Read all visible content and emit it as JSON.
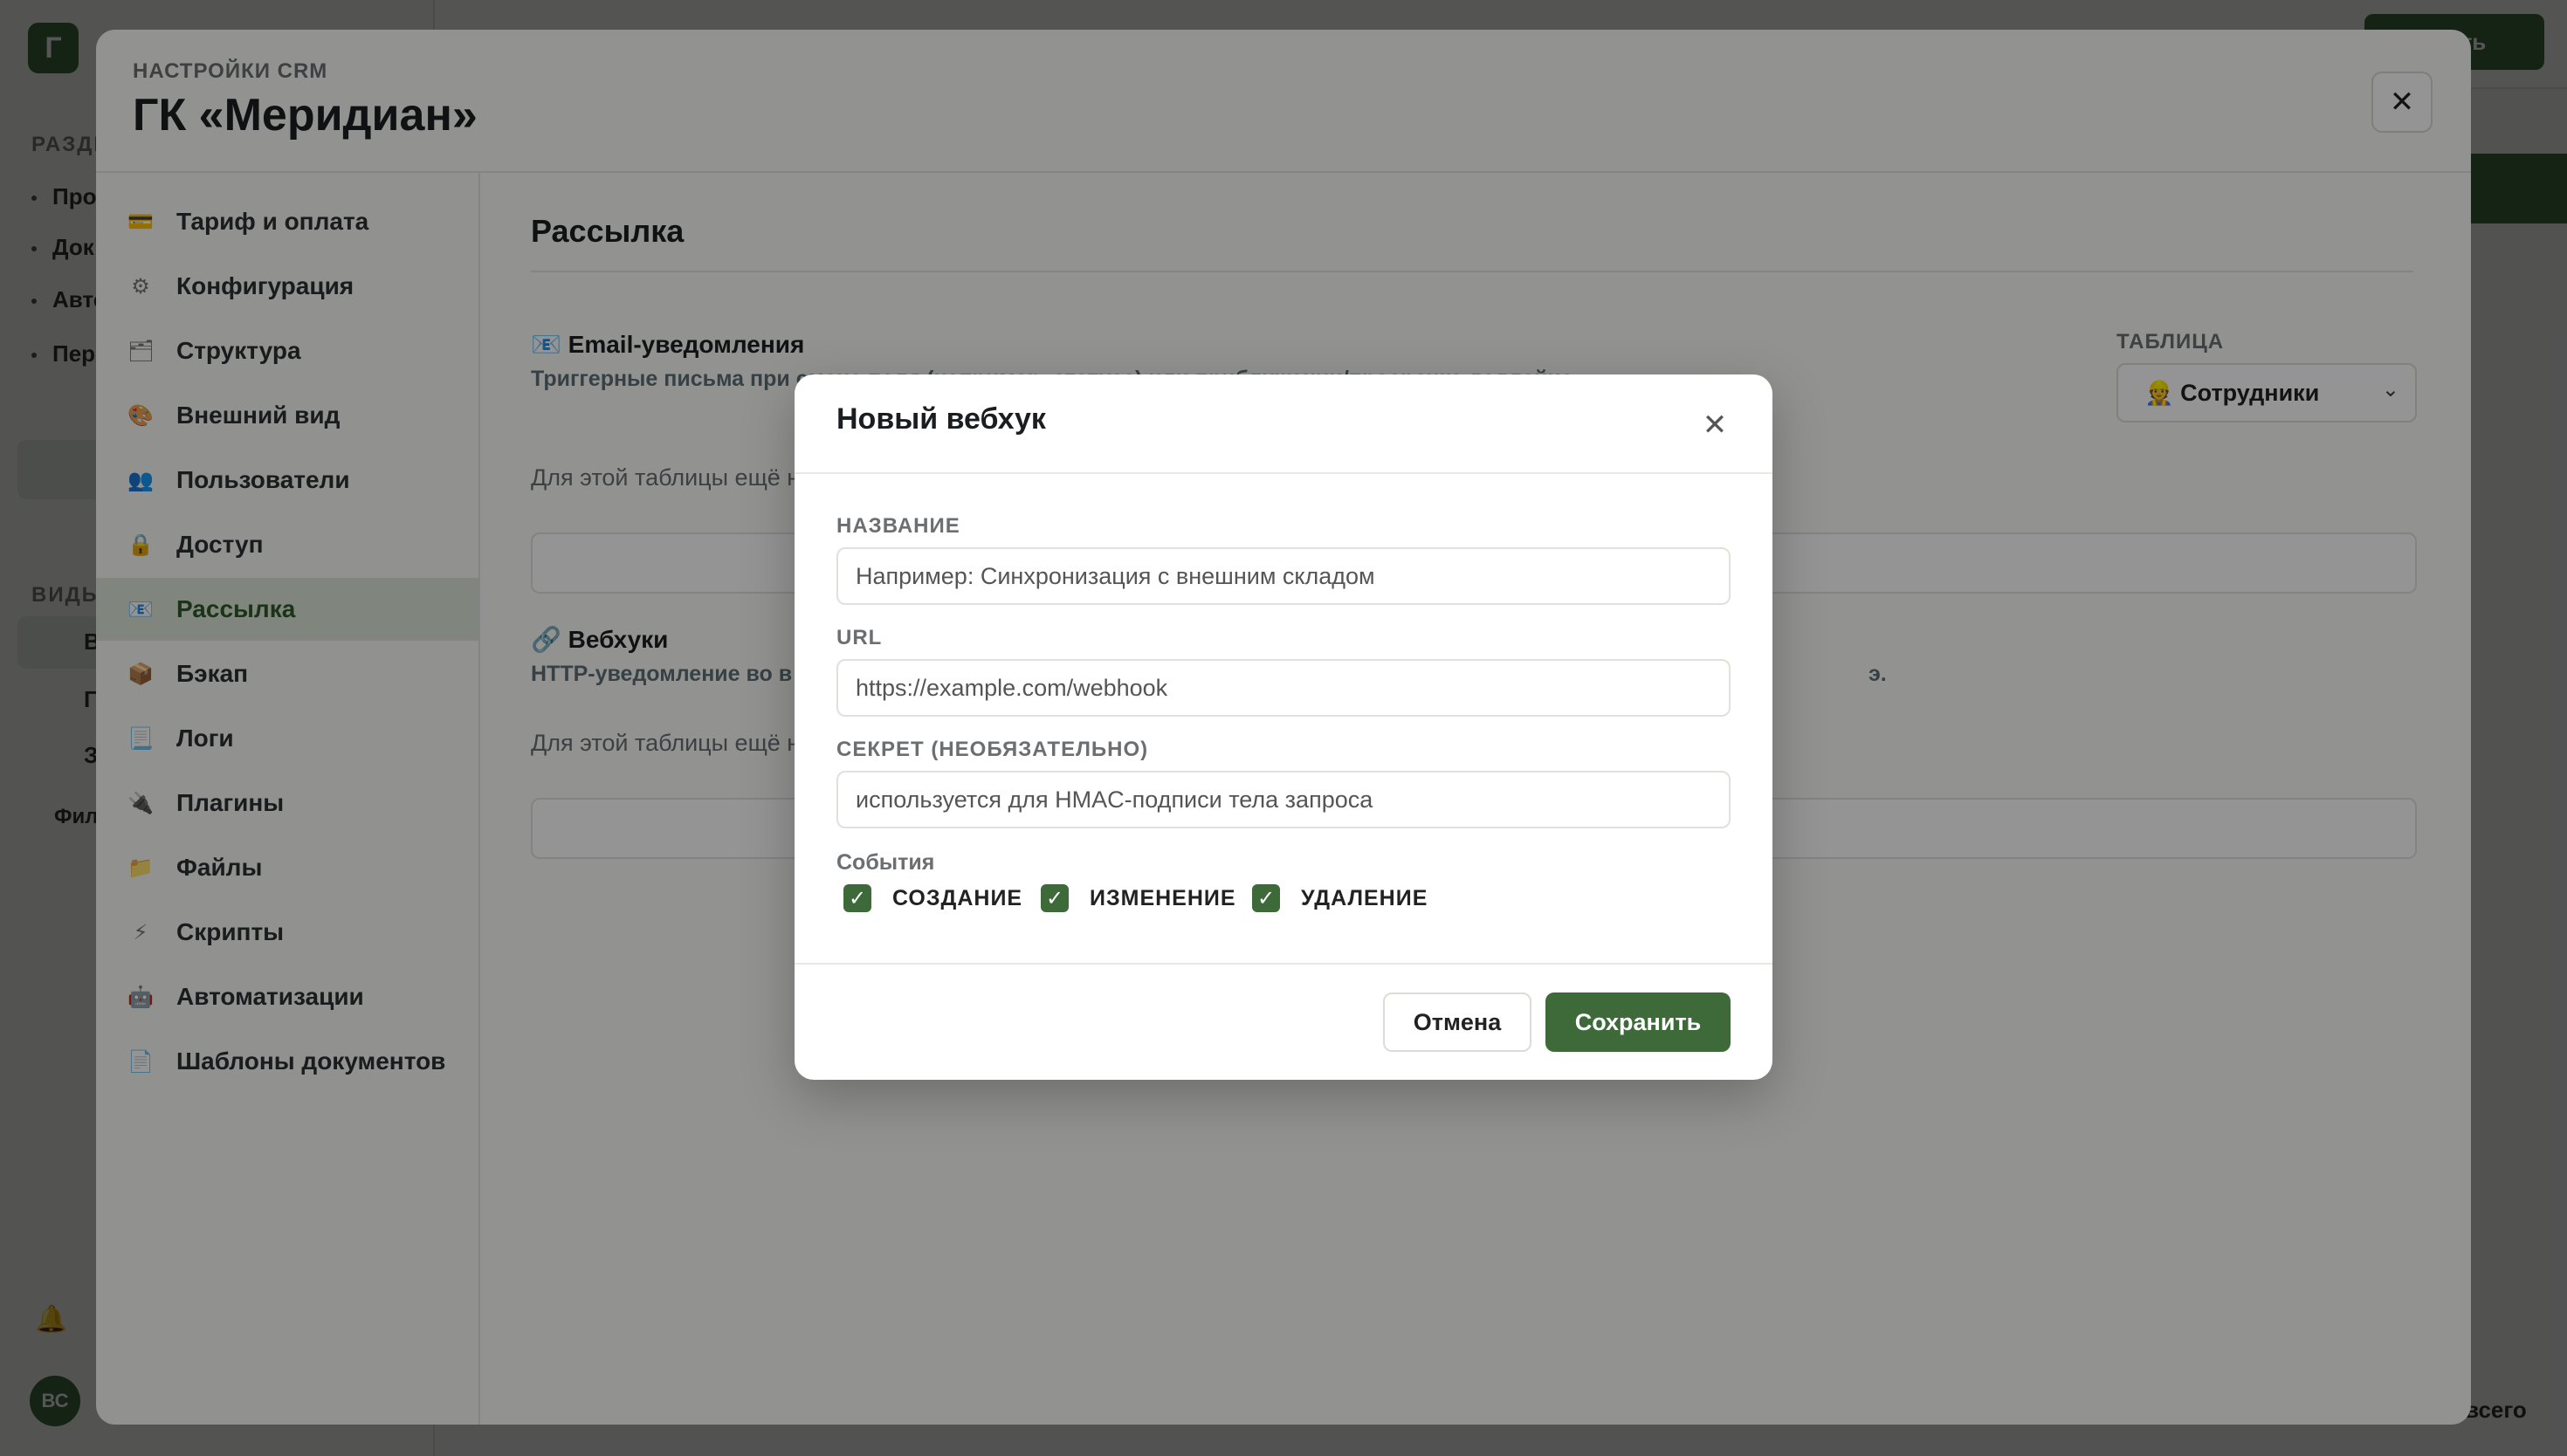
{
  "app": {
    "logo": "Г",
    "sections_label": "РАЗДЕ",
    "items": [
      "Про",
      "Док",
      "Авто",
      "Пер"
    ],
    "views_label": "ВИДЫ",
    "view_items": [
      "В",
      "Г",
      "З"
    ],
    "filter": "Фил",
    "top_button": "здать",
    "total": "о всего",
    "avatar": "ВС"
  },
  "settings": {
    "eyebrow": "НАСТРОЙКИ CRM",
    "title": "ГК «Меридиан»",
    "close_icon": "✕",
    "nav": [
      {
        "icon": "💳",
        "label": "Тариф и оплата"
      },
      {
        "icon": "⚙",
        "label": "Конфигурация"
      },
      {
        "icon": "🗂",
        "label": "Структура"
      },
      {
        "icon": "🎨",
        "label": "Внешний вид"
      },
      {
        "icon": "👥",
        "label": "Пользователи"
      },
      {
        "icon": "🔒",
        "label": "Доступ"
      },
      {
        "icon": "📧",
        "label": "Рассылка"
      },
      {
        "icon": "📦",
        "label": "Бэкап"
      },
      {
        "icon": "📃",
        "label": "Логи"
      },
      {
        "icon": "🔌",
        "label": "Плагины"
      },
      {
        "icon": "📁",
        "label": "Файлы"
      },
      {
        "icon": "⚡",
        "label": "Скрипты"
      },
      {
        "icon": "🤖",
        "label": "Автоматизации"
      },
      {
        "icon": "📄",
        "label": "Шаблоны документов"
      }
    ],
    "active_nav": "Рассылка",
    "main": {
      "title": "Рассылка",
      "email_title": "📧 Email-уведомления",
      "email_desc": "Триггерные письма при смене поля (например, статуса) или приближении/просрочке дедлайна.",
      "table_label": "ТАБЛИЦА",
      "table_value": "👷 Сотрудники",
      "email_empty": "Для этой таблицы ещё н",
      "webhooks_title": "🔗 Вебхуки",
      "webhooks_desc": "HTTP-уведомление во в",
      "webhooks_desc_tail": "э.",
      "webhooks_empty": "Для этой таблицы ещё н"
    }
  },
  "dialog": {
    "title": "Новый вебхук",
    "close_icon": "✕",
    "name_label": "НАЗВАНИЕ",
    "name_placeholder": "Например: Синхронизация с внешним складом",
    "url_label": "URL",
    "url_placeholder": "https://example.com/webhook",
    "secret_label": "СЕКРЕТ (НЕОБЯЗАТЕЛЬНО)",
    "secret_placeholder": "используется для HMAC-подписи тела запроса",
    "events_label": "События",
    "events": [
      {
        "label": "СОЗДАНИЕ",
        "checked": true
      },
      {
        "label": "ИЗМЕНЕНИЕ",
        "checked": true
      },
      {
        "label": "УДАЛЕНИЕ",
        "checked": true
      }
    ],
    "cancel": "Отмена",
    "save": "Сохранить"
  },
  "colors": {
    "accent": "#3e6a3a",
    "active_nav_bg": "#dde6da"
  }
}
